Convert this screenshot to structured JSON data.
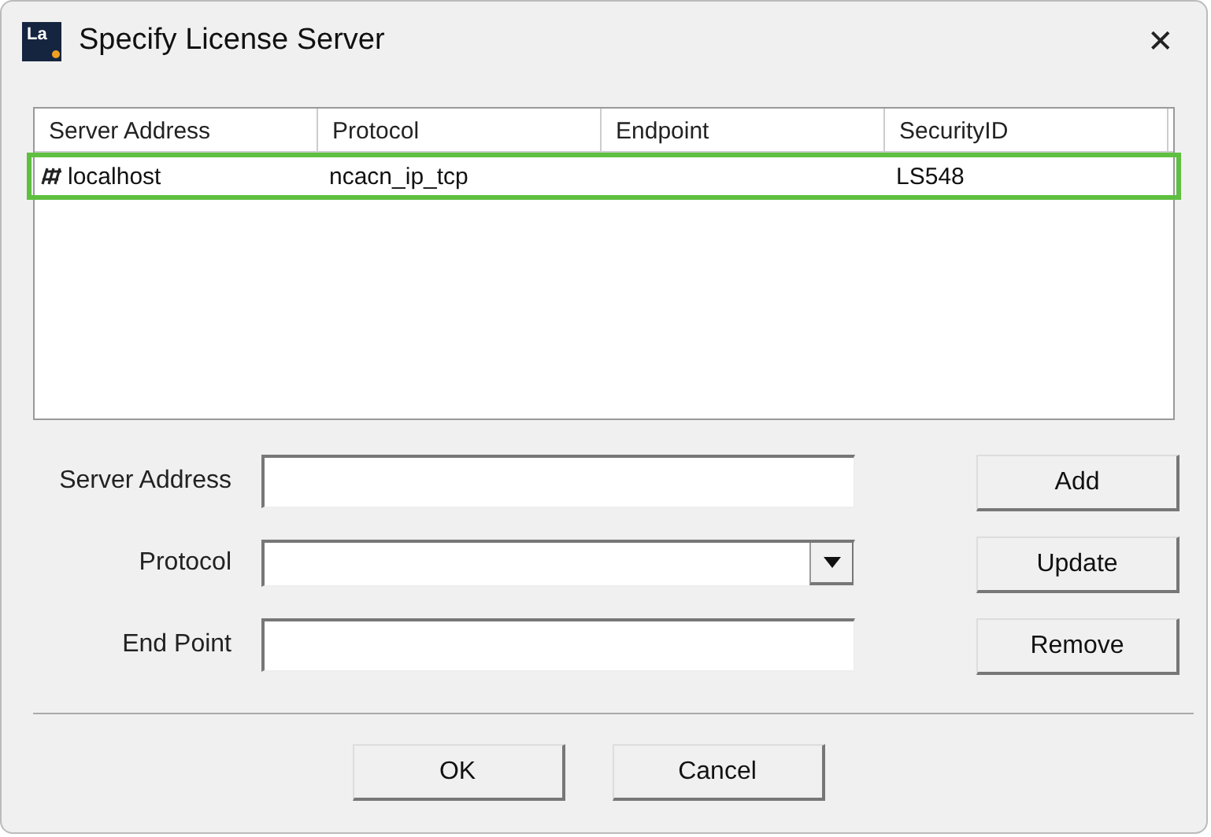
{
  "window": {
    "app_icon": "La",
    "title": "Specify License Server",
    "close": "✕"
  },
  "table": {
    "columns": [
      "Server Address",
      "Protocol",
      "Endpoint",
      "SecurityID"
    ],
    "rows": [
      {
        "cells": [
          "localhost",
          "ncacn_ip_tcp",
          "",
          "LS548"
        ],
        "selected": true
      }
    ]
  },
  "form": [
    {
      "label": "Server Address",
      "kind": "text"
    },
    {
      "label": "Protocol",
      "kind": "dropdown"
    },
    {
      "label": "End Point",
      "kind": "text"
    }
  ],
  "side_buttons": [
    "Add",
    "Update",
    "Remove"
  ],
  "buttons": [
    "OK",
    "Cancel"
  ]
}
